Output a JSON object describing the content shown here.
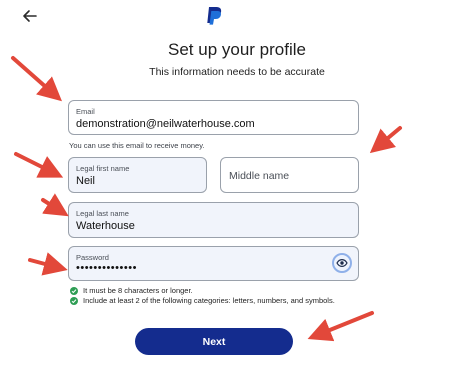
{
  "header": {
    "back_icon": "arrow-left-icon",
    "logo_icon": "paypal-logo-icon",
    "brand_color": "#142c8e"
  },
  "main": {
    "title": "Set up your profile",
    "subtitle": "This information needs to be accurate"
  },
  "email": {
    "label": "Email",
    "value": "demonstration@neilwaterhouse.com",
    "hint": "You can use this email to receive money."
  },
  "first_name": {
    "label": "Legal first name",
    "value": "Neil"
  },
  "middle_name": {
    "placeholder": "Middle name"
  },
  "last_name": {
    "label": "Legal last name",
    "value": "Waterhouse"
  },
  "password": {
    "label": "Password",
    "value": "••••••••••••••",
    "toggle_icon": "eye-icon",
    "rules": [
      {
        "text": "It must be 8 characters or longer.",
        "met": true
      },
      {
        "text": "Include at least 2 of the following categories: letters, numbers, and symbols.",
        "met": true
      }
    ]
  },
  "actions": {
    "next_label": "Next"
  },
  "annotations": {
    "arrow_color": "#e2483a"
  }
}
